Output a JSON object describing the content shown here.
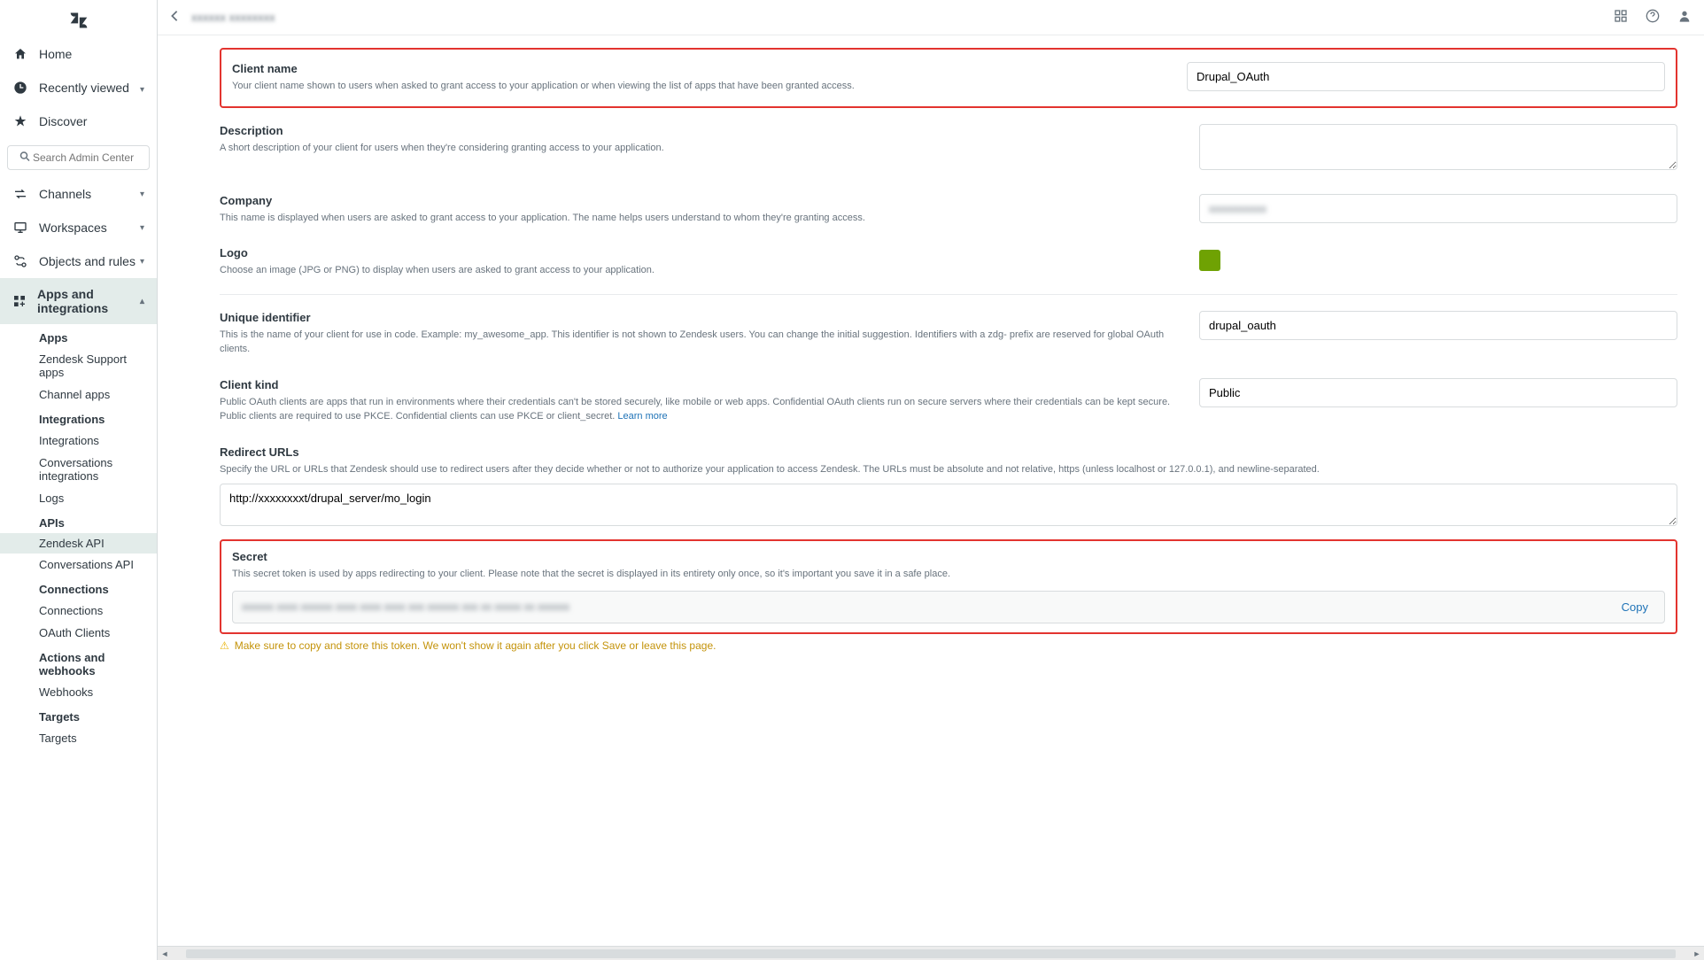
{
  "sidebar": {
    "top": [
      {
        "label": "Home",
        "icon": "home"
      },
      {
        "label": "Recently viewed",
        "icon": "clock",
        "expandable": true
      },
      {
        "label": "Discover",
        "icon": "star"
      }
    ],
    "search_placeholder": "Search Admin Center",
    "sections": [
      {
        "label": "Channels",
        "icon": "arrows"
      },
      {
        "label": "Workspaces",
        "icon": "monitor"
      },
      {
        "label": "Objects and rules",
        "icon": "objects"
      },
      {
        "label": "Apps and integrations",
        "icon": "apps",
        "active": true
      }
    ],
    "subgroups": [
      {
        "heading": "Apps",
        "items": [
          "Zendesk Support apps",
          "Channel apps"
        ]
      },
      {
        "heading": "Integrations",
        "items": [
          "Integrations",
          "Conversations integrations",
          "Logs"
        ]
      },
      {
        "heading": "APIs",
        "items": [
          "Zendesk API",
          "Conversations API"
        ],
        "highlight": "Zendesk API"
      },
      {
        "heading": "Connections",
        "items": [
          "Connections",
          "OAuth Clients"
        ]
      },
      {
        "heading": "Actions and webhooks",
        "items": [
          "Webhooks"
        ]
      },
      {
        "heading": "Targets",
        "items": [
          "Targets"
        ]
      }
    ]
  },
  "topbar": {
    "breadcrumb": "xxxxxx xxxxxxxx"
  },
  "form": {
    "client_name": {
      "label": "Client name",
      "help": "Your client name shown to users when asked to grant access to your application or when viewing the list of apps that have been granted access.",
      "value": "Drupal_OAuth"
    },
    "description": {
      "label": "Description",
      "help": "A short description of your client for users when they're considering granting access to your application.",
      "value": ""
    },
    "company": {
      "label": "Company",
      "help": "This name is displayed when users are asked to grant access to your application. The name helps users understand to whom they're granting access.",
      "value": "xxxxxxxxxx"
    },
    "logo": {
      "label": "Logo",
      "help": "Choose an image (JPG or PNG) to display when users are asked to grant access to your application."
    },
    "unique_identifier": {
      "label": "Unique identifier",
      "help": "This is the name of your client for use in code. Example: my_awesome_app. This identifier is not shown to Zendesk users. You can change the initial suggestion. Identifiers with a zdg- prefix are reserved for global OAuth clients.",
      "value": "drupal_oauth"
    },
    "client_kind": {
      "label": "Client kind",
      "help": "Public OAuth clients are apps that run in environments where their credentials can't be stored securely, like mobile or web apps. Confidential OAuth clients run on secure servers where their credentials can be kept secure. Public clients are required to use PKCE. Confidential clients can use PKCE or client_secret. ",
      "learn_more": "Learn more",
      "value": "Public"
    },
    "redirect_urls": {
      "label": "Redirect URLs",
      "help": "Specify the URL or URLs that Zendesk should use to redirect users after they decide whether or not to authorize your application to access Zendesk. The URLs must be absolute and not relative, https (unless localhost or 127.0.0.1), and newline-separated.",
      "value": "http://xxxxxxxxt/drupal_server/mo_login"
    },
    "secret": {
      "label": "Secret",
      "help": "This secret token is used by apps redirecting to your client. Please note that the secret is displayed in its entirety only once, so it's important you save it in a safe place.",
      "value": "xxxxxx xxxx xxxxxx xxxx xxxx xxxx xxx xxxxxx xxx xx xxxxx xx xxxxxx",
      "copy": "Copy",
      "warning": "Make sure to copy and store this token. We won't show it again after you click Save or leave this page."
    }
  }
}
